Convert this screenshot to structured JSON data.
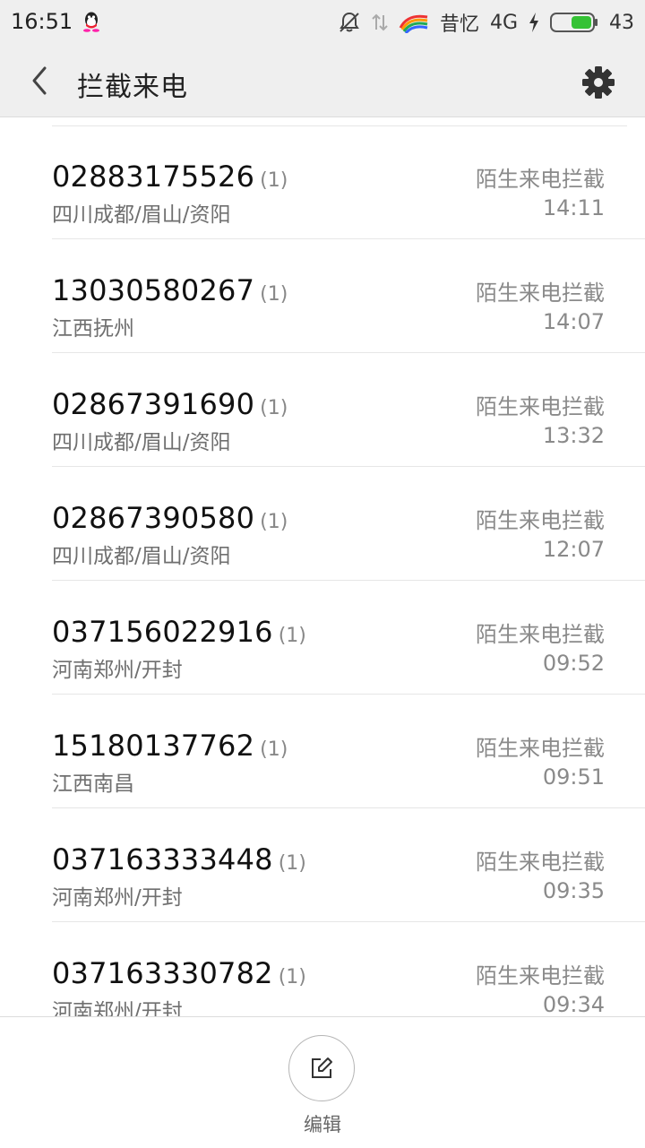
{
  "status_bar": {
    "time": "16:51",
    "carrier": "昔忆",
    "network": "4G",
    "battery": "43",
    "icons": [
      "qq-icon",
      "mute-icon",
      "data-arrows-icon",
      "rainbow-icon",
      "charging-icon",
      "battery-icon"
    ]
  },
  "app_bar": {
    "title": "拦截来电",
    "back_icon": "chevron-left-icon",
    "settings_icon": "gear-icon"
  },
  "calls": [
    {
      "number": "02883175526",
      "count": "(1)",
      "location": "四川成都/眉山/资阳",
      "tag": "陌生来电拦截",
      "time": "14:11"
    },
    {
      "number": "13030580267",
      "count": "(1)",
      "location": "江西抚州",
      "tag": "陌生来电拦截",
      "time": "14:07"
    },
    {
      "number": "02867391690",
      "count": "(1)",
      "location": "四川成都/眉山/资阳",
      "tag": "陌生来电拦截",
      "time": "13:32"
    },
    {
      "number": "02867390580",
      "count": "(1)",
      "location": "四川成都/眉山/资阳",
      "tag": "陌生来电拦截",
      "time": "12:07"
    },
    {
      "number": "037156022916",
      "count": "(1)",
      "location": "河南郑州/开封",
      "tag": "陌生来电拦截",
      "time": "09:52"
    },
    {
      "number": "15180137762",
      "count": "(1)",
      "location": "江西南昌",
      "tag": "陌生来电拦截",
      "time": "09:51"
    },
    {
      "number": "037163333448",
      "count": "(1)",
      "location": "河南郑州/开封",
      "tag": "陌生来电拦截",
      "time": "09:35"
    },
    {
      "number": "037163330782",
      "count": "(1)",
      "location": "河南郑州/开封",
      "tag": "陌生来电拦截",
      "time": "09:34"
    }
  ],
  "bottom": {
    "edit_label": "编辑",
    "edit_icon": "edit-icon"
  },
  "colors": {
    "header_bg": "#efefef",
    "battery_green": "#35c235",
    "divider": "#e6e6e6"
  }
}
